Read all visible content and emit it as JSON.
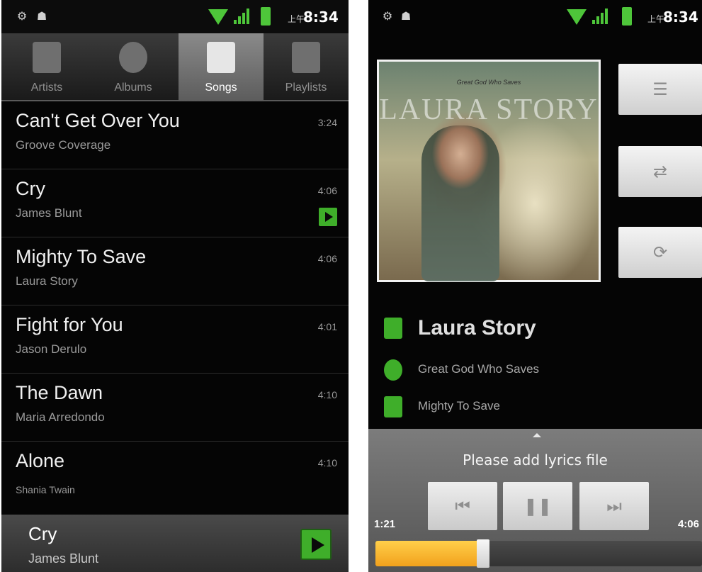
{
  "status_bar": {
    "ampm": "上午",
    "time": "8:34"
  },
  "library": {
    "tabs": [
      {
        "label": "Artists",
        "icon": "microphone-icon",
        "active": false
      },
      {
        "label": "Albums",
        "icon": "disc-icon",
        "active": false
      },
      {
        "label": "Songs",
        "icon": "music-note-icon",
        "active": true
      },
      {
        "label": "Playlists",
        "icon": "list-icon",
        "active": false
      }
    ],
    "songs": [
      {
        "title": "Can't Get Over You",
        "artist": "Groove Coverage",
        "duration": "3:24",
        "playing": false
      },
      {
        "title": "Cry",
        "artist": "James Blunt",
        "duration": "4:06",
        "playing": true
      },
      {
        "title": "Mighty To Save",
        "artist": "Laura Story",
        "duration": "4:06",
        "playing": false
      },
      {
        "title": "Fight for You",
        "artist": "Jason Derulo",
        "duration": "4:01",
        "playing": false
      },
      {
        "title": "The Dawn",
        "artist": "Maria Arredondo",
        "duration": "4:10",
        "playing": false
      },
      {
        "title": "Alone",
        "artist": "Shania Twain",
        "duration": "4:10",
        "playing": false
      }
    ],
    "now_playing": {
      "title": "Cry",
      "artist": "James Blunt"
    }
  },
  "player": {
    "album_art": {
      "small_text": "Great God Who Saves",
      "big_text": "LAURA STORY"
    },
    "side_buttons": [
      {
        "name": "playlist-button",
        "icon": "list-icon"
      },
      {
        "name": "shuffle-button",
        "icon": "shuffle-icon"
      },
      {
        "name": "repeat-button",
        "icon": "repeat-icon"
      }
    ],
    "artist": "Laura Story",
    "album": "Great God Who Saves",
    "song": "Mighty To Save",
    "lyrics_text": "Please add lyrics file",
    "current_time": "1:21",
    "total_time": "4:06",
    "progress_fraction": 0.33
  },
  "colors": {
    "accent_green": "#3fae2a",
    "progress_orange": "#f2a11c",
    "background": "#050505"
  }
}
